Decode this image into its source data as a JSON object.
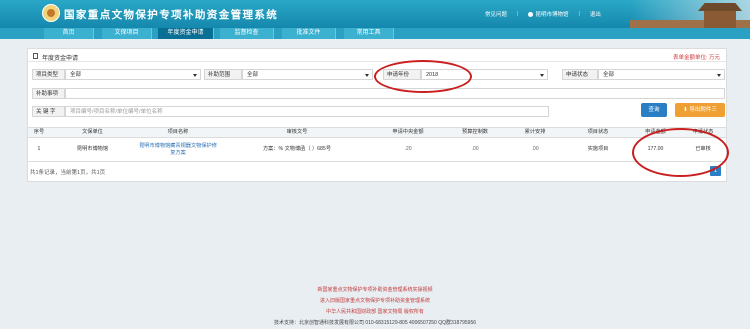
{
  "header": {
    "title": "国家重点文物保护专项补助资金管理系统",
    "help_link": "常见问题",
    "user_name": "昆明市博物馆",
    "logout": "退出"
  },
  "nav": {
    "items": [
      "首页",
      "文保项目",
      "年度资金申请",
      "监督检查",
      "批准文件",
      "常用工具"
    ],
    "active_index": 2
  },
  "panel": {
    "title": "年度资金申请",
    "unit_note": "表单金额单位: 万元"
  },
  "filters": {
    "project_type_label": "项目类型",
    "project_type_value": "全部",
    "subsidy_scope_label": "补助范围",
    "subsidy_scope_value": "全部",
    "apply_year_label": "申请年份",
    "apply_year_value": "2018",
    "apply_status_label": "申请状态",
    "apply_status_value": "全部",
    "subsidy_item_label": "补助事项",
    "keyword_label": "关 键 字",
    "keyword_placeholder": "项目编号/项目名称/单位编号/单位名称",
    "query_button": "查询",
    "export_button": "导出附件三"
  },
  "table": {
    "columns": [
      "序号",
      "文保单位",
      "项目名称",
      "审核文号",
      "申请中央金额",
      "预算控制数",
      "累计安排",
      "项目状态",
      "申请金额",
      "申请状态"
    ],
    "rows": [
      {
        "index": "1",
        "unit": "昆明市博物馆",
        "project": "昆明市博物馆藏青铜器文物保护修复方案",
        "doc_no": "方案：% 文物博函（          ）685号",
        "central_amount": "       .20",
        "budget_control": "           .00",
        "cumulative": "           .00",
        "project_status": "实施项目",
        "apply_amount": "177.00",
        "apply_status": "已审核"
      }
    ]
  },
  "pagination": {
    "summary": "共1条记录，当前第1页，共1页",
    "current_page": "1"
  },
  "footer": {
    "line1": "新国家重点文物保护专项补助资金管理系统实操视频",
    "line2": "进入旧版国家重点文物保护专项补助资金管理系统",
    "line3": "中华人民共和国财政部 国家文物局 版权所有",
    "line4": "技术支持：北京创智通科技发展有限公司 010-68315129-805 4006507250 QQ群318795956"
  },
  "colors": {
    "header_bg": "#1f9bbd",
    "nav_active": "#0a6f94",
    "query_btn": "#2a7fc4",
    "export_btn": "#f0a033",
    "annotation": "#c91f1f",
    "unit_note": "#d23a3a"
  }
}
